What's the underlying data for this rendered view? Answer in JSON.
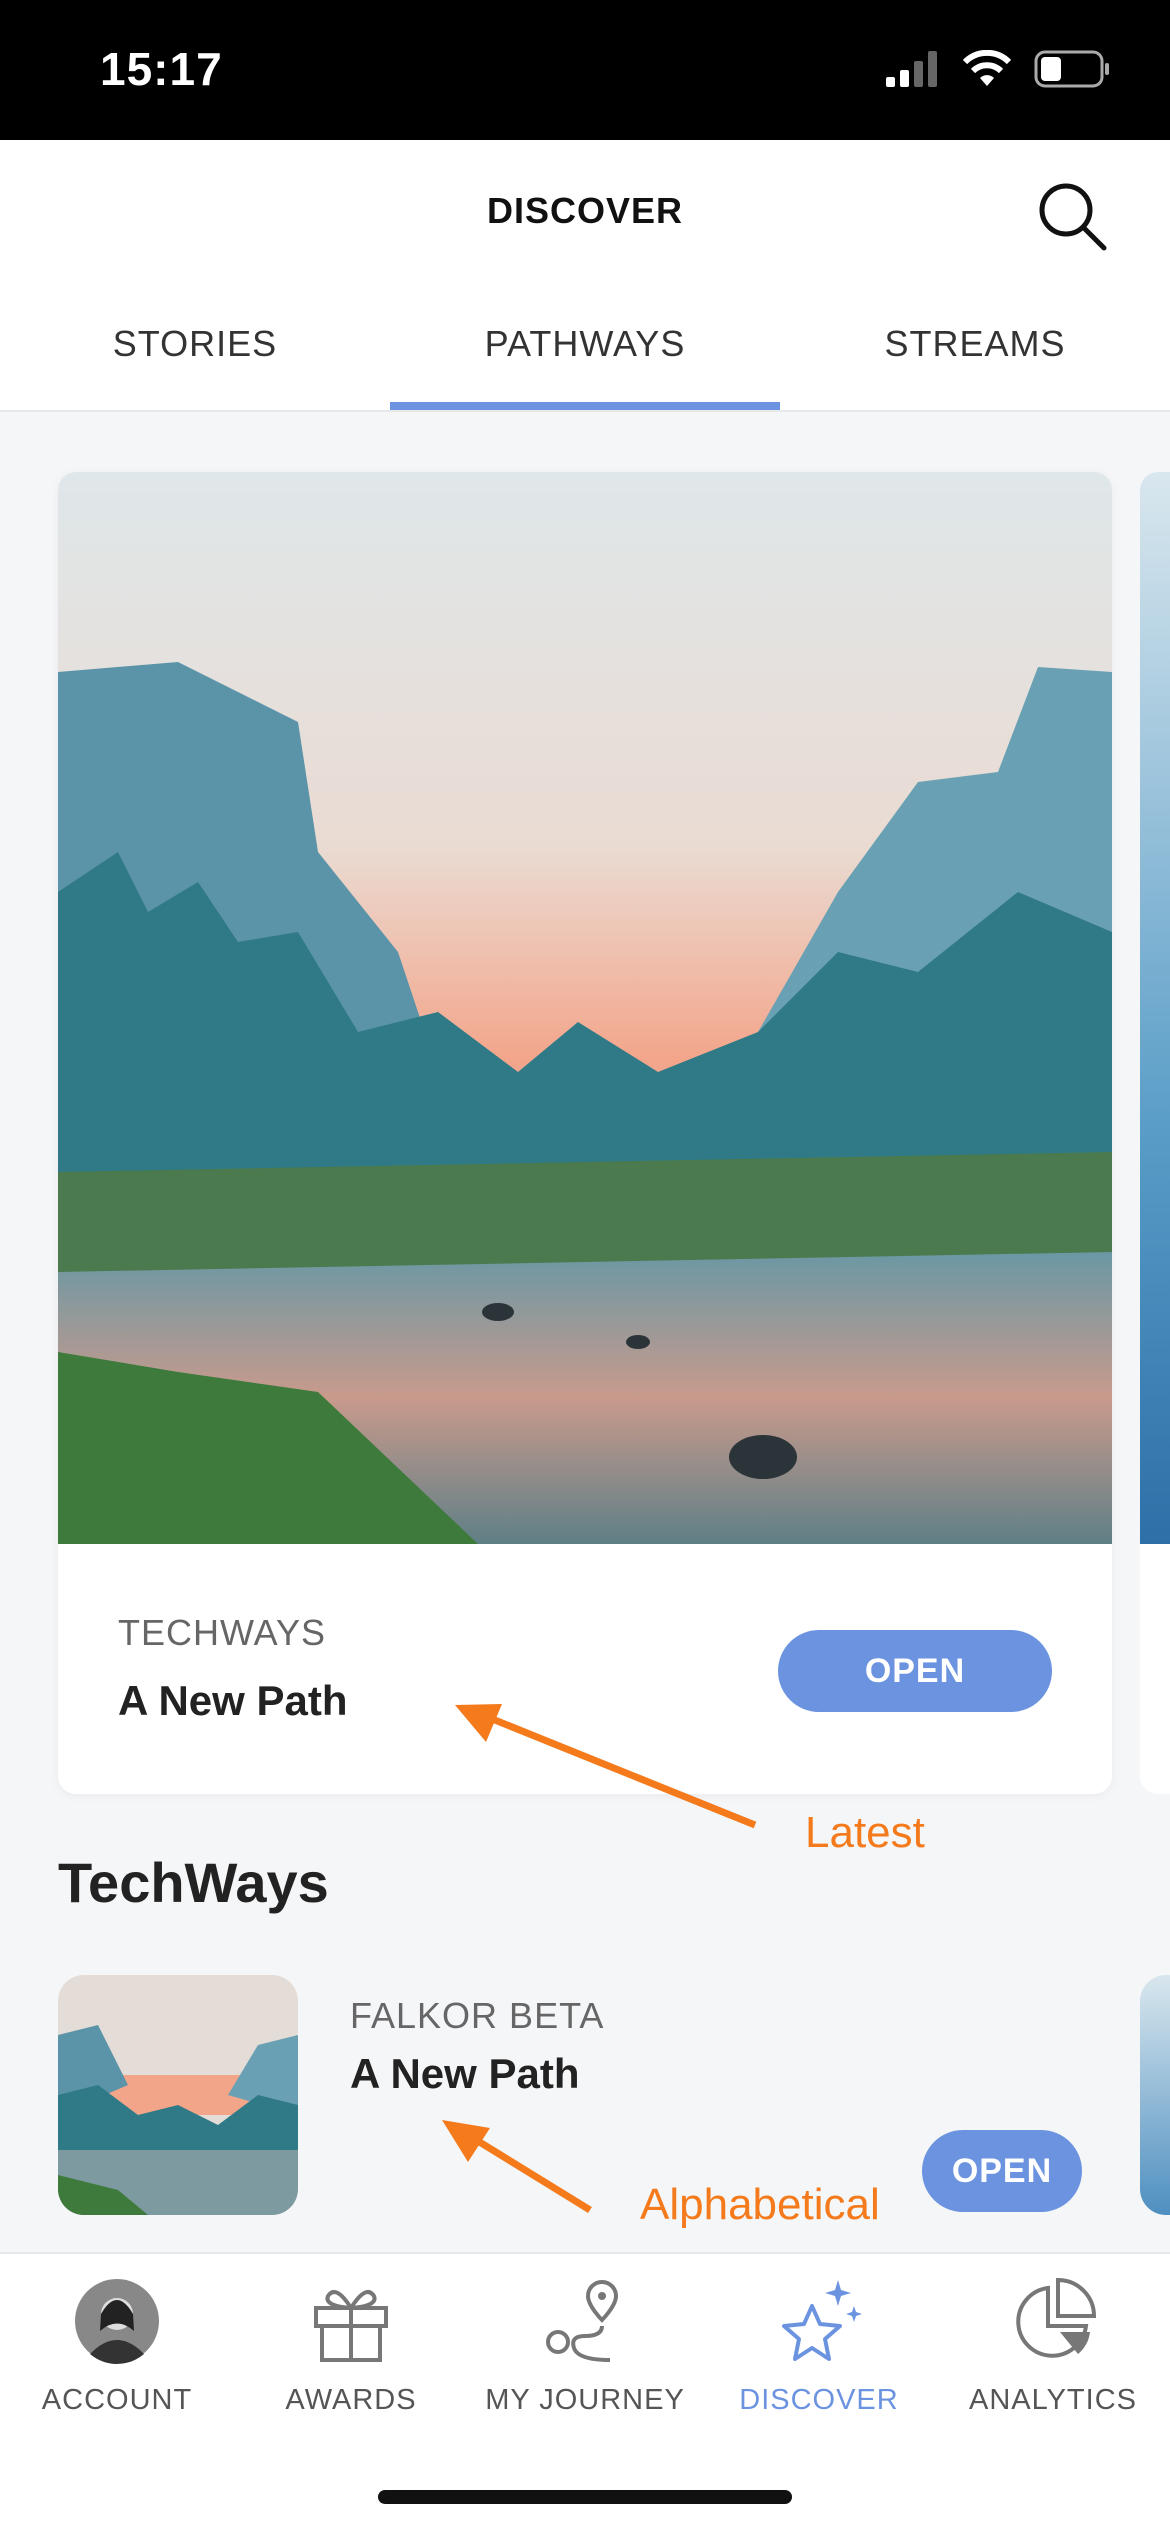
{
  "status_bar": {
    "time": "15:17"
  },
  "header": {
    "title": "DISCOVER"
  },
  "tabs": [
    {
      "label": "STORIES",
      "active": false
    },
    {
      "label": "PATHWAYS",
      "active": true
    },
    {
      "label": "STREAMS",
      "active": false
    }
  ],
  "featured_card": {
    "category": "TECHWAYS",
    "title": "A New Path",
    "open_label": "OPEN"
  },
  "annotations": {
    "latest": "Latest",
    "alphabetical": "Alphabetical"
  },
  "section": {
    "title": "TechWays",
    "items": [
      {
        "category": "FALKOR BETA",
        "title": "A New Path",
        "open_label": "OPEN"
      }
    ]
  },
  "bottom_nav": [
    {
      "label": "ACCOUNT",
      "icon": "avatar-icon",
      "active": false
    },
    {
      "label": "AWARDS",
      "icon": "gift-icon",
      "active": false
    },
    {
      "label": "MY JOURNEY",
      "icon": "route-icon",
      "active": false
    },
    {
      "label": "DISCOVER",
      "icon": "sparkle-star-icon",
      "active": true
    },
    {
      "label": "ANALYTICS",
      "icon": "pie-chart-icon",
      "active": false
    }
  ],
  "colors": {
    "accent": "#6b93e0",
    "annotation": "#f47a1c"
  }
}
